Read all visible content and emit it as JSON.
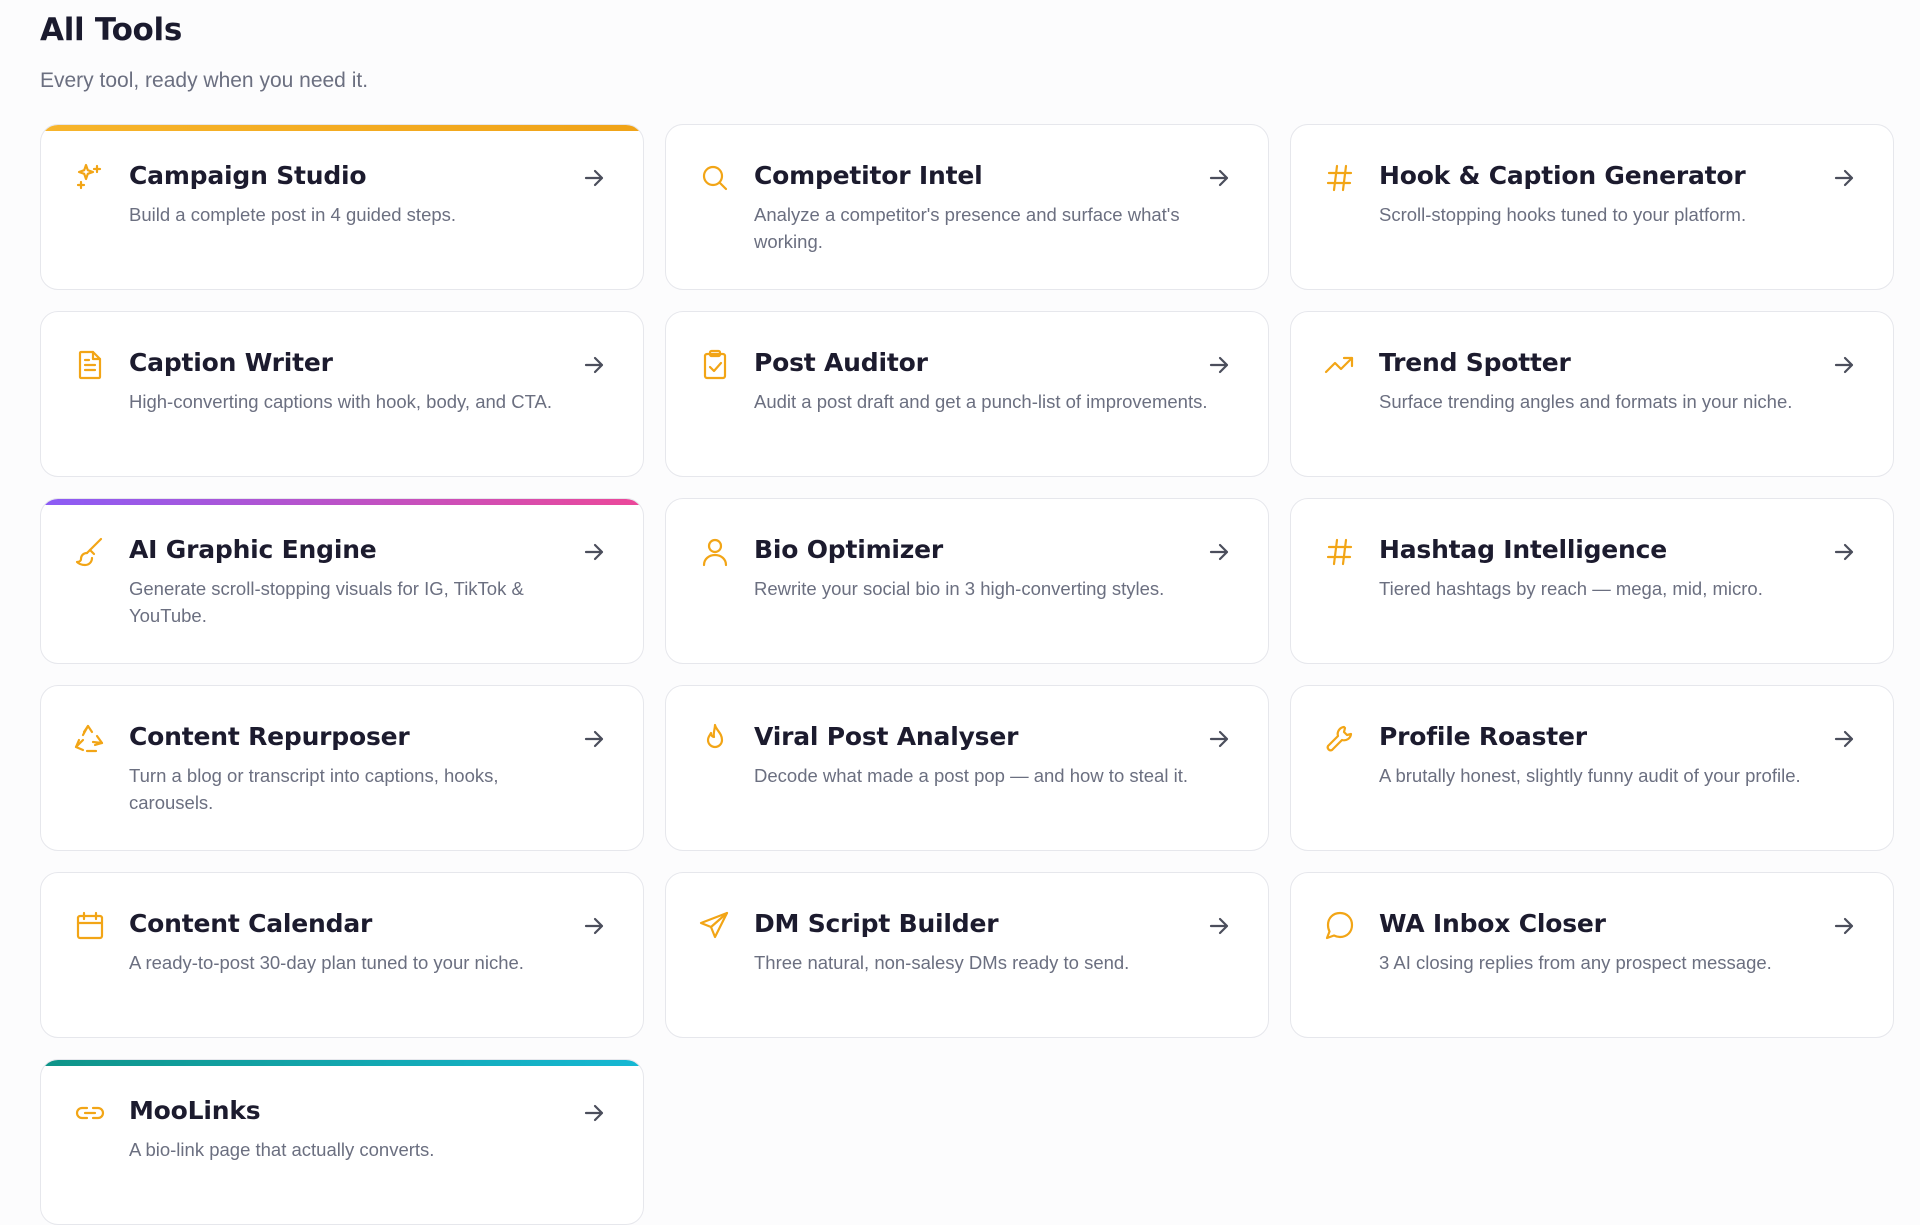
{
  "header": {
    "title": "All Tools",
    "subtitle": "Every tool, ready when you need it."
  },
  "colors": {
    "icon": "#f2a516",
    "arrow": "#4b4e5c",
    "accent_orange": [
      "#f7b52c",
      "#f0a318"
    ],
    "accent_purple_pink": [
      "#8b5cf6",
      "#ec4899"
    ],
    "accent_teal": [
      "#0f9488",
      "#16b8d4"
    ]
  },
  "tools": [
    {
      "name": "Campaign Studio",
      "desc": "Build a complete post in 4 guided steps.",
      "icon": "sparkles-icon",
      "accent": "accent_orange"
    },
    {
      "name": "Competitor Intel",
      "desc": "Analyze a competitor's presence and surface what's working.",
      "icon": "search-icon"
    },
    {
      "name": "Hook & Caption Generator",
      "desc": "Scroll-stopping hooks tuned to your platform.",
      "icon": "hashtag-icon"
    },
    {
      "name": "Caption Writer",
      "desc": "High-converting captions with hook, body, and CTA.",
      "icon": "document-icon"
    },
    {
      "name": "Post Auditor",
      "desc": "Audit a post draft and get a punch-list of improvements.",
      "icon": "clipboard-check-icon"
    },
    {
      "name": "Trend Spotter",
      "desc": "Surface trending angles and formats in your niche.",
      "icon": "trending-up-icon"
    },
    {
      "name": "AI Graphic Engine",
      "desc": "Generate scroll-stopping visuals for IG, TikTok & YouTube.",
      "icon": "brush-icon",
      "accent": "accent_purple_pink"
    },
    {
      "name": "Bio Optimizer",
      "desc": "Rewrite your social bio in 3 high-converting styles.",
      "icon": "user-icon"
    },
    {
      "name": "Hashtag Intelligence",
      "desc": "Tiered hashtags by reach — mega, mid, micro.",
      "icon": "hashtag-icon"
    },
    {
      "name": "Content Repurposer",
      "desc": "Turn a blog or transcript into captions, hooks, carousels.",
      "icon": "recycle-icon"
    },
    {
      "name": "Viral Post Analyser",
      "desc": "Decode what made a post pop — and how to steal it.",
      "icon": "flame-icon"
    },
    {
      "name": "Profile Roaster",
      "desc": "A brutally honest, slightly funny audit of your profile.",
      "icon": "wrench-icon"
    },
    {
      "name": "Content Calendar",
      "desc": "A ready-to-post 30-day plan tuned to your niche.",
      "icon": "calendar-icon"
    },
    {
      "name": "DM Script Builder",
      "desc": "Three natural, non-salesy DMs ready to send.",
      "icon": "send-icon"
    },
    {
      "name": "WA Inbox Closer",
      "desc": "3 AI closing replies from any prospect message.",
      "icon": "chat-bubble-icon"
    },
    {
      "name": "MooLinks",
      "desc": "A bio-link page that actually converts.",
      "icon": "link-icon",
      "accent": "accent_teal"
    }
  ]
}
